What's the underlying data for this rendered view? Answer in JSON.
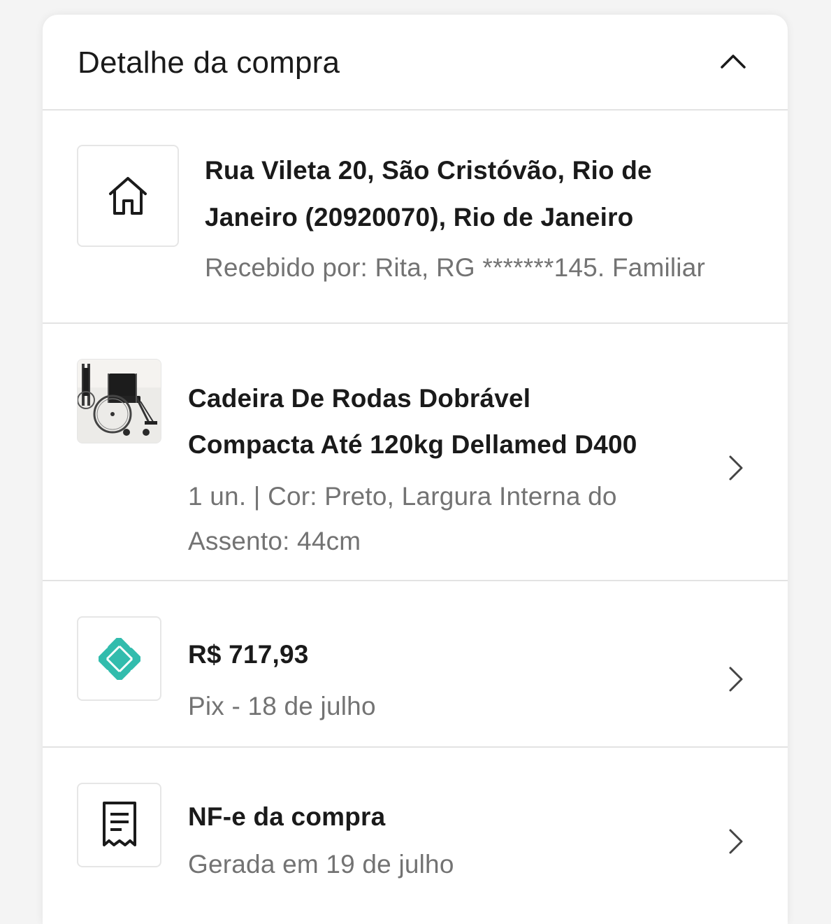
{
  "header": {
    "title": "Detalhe da compra",
    "collapse_icon": "chevron-up-icon"
  },
  "address": {
    "icon": "home-icon",
    "line1": "Rua Vileta 20, São Cristóvão, Rio de",
    "line2": "Janeiro (20920070), Rio de Janeiro",
    "received_by": "Recebido por: Rita, RG *******145. Familiar"
  },
  "product": {
    "thumbnail": "wheelchair-product-image",
    "name_line1": "Cadeira De Rodas Dobrável",
    "name_line2": "Compacta Até 120kg Dellamed D400",
    "details_line1": "1 un. | Cor: Preto, Largura Interna do",
    "details_line2": "Assento: 44cm"
  },
  "payment": {
    "icon": "pix-icon",
    "amount": "R$ 717,93",
    "method": "Pix - 18 de julho"
  },
  "invoice": {
    "icon": "receipt-icon",
    "title": "NF-e da compra",
    "generated": "Gerada em 19 de julho"
  },
  "colors": {
    "pix": "#32bcad",
    "text_primary": "#1a1a1a",
    "text_secondary": "#737373",
    "divider": "#e3e3e3"
  }
}
